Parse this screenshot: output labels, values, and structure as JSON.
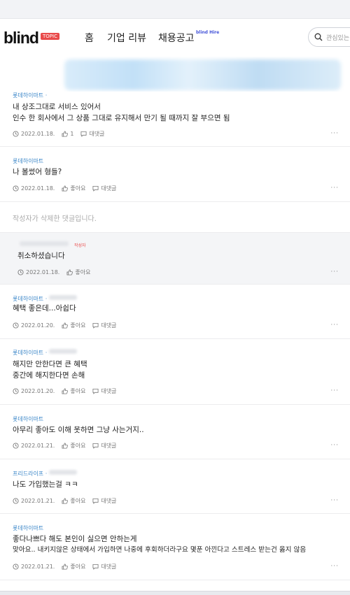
{
  "header": {
    "logo": "blind",
    "topic_badge": "TOPIC",
    "nav_home": "홈",
    "nav_review": "기업 리뷰",
    "nav_jobs": "채용공고",
    "hire_badge": "blind Hire",
    "search_placeholder": "관심있는"
  },
  "comments": [
    {
      "company": "롯데하이마트 · ",
      "lines": [
        "내 상조그대로 서비스 있어서",
        "인수 한 회사에서 그 상품 그대로 유지해서 만기 될 때까지 잘 부으면 됨"
      ],
      "date": "2022.01.18.",
      "like": "1",
      "reply": "대댓글",
      "more": "···"
    },
    {
      "company": "롯데하이마트",
      "lines": [
        "나 볼썼어 형들?"
      ],
      "date": "2022.01.18.",
      "like": "좋아요",
      "reply": "대댓글",
      "more": "···"
    },
    {
      "deleted": "작성자가 삭제한 댓글입니다."
    },
    {
      "author_tag": "작성자",
      "lines": [
        "취소하셨습니다"
      ],
      "date": "2022.01.18.",
      "like": "좋아요",
      "more": "···"
    },
    {
      "company": "롯데하이마트 · ",
      "lines": [
        "혜택 좋은데...아쉽다"
      ],
      "date": "2022.01.20.",
      "like": "좋아요",
      "reply": "대댓글",
      "more": "···"
    },
    {
      "company": "롯데하이마트 · ",
      "lines": [
        "해지만 안한다면 큰 혜택",
        "중간에 해지한다면 손해"
      ],
      "date": "2022.01.20.",
      "like": "좋아요",
      "reply": "대댓글",
      "more": "···"
    },
    {
      "company": "롯데하이마트",
      "lines": [
        "아무리 좋아도 이해 못하면 그냥 사는거지.."
      ],
      "date": "2022.01.21.",
      "like": "좋아요",
      "reply": "대댓글",
      "more": "···"
    },
    {
      "company": "프리드라이프 · ",
      "lines": [
        "나도 가입했는걸 ㅋㅋ"
      ],
      "date": "2022.01.21.",
      "like": "좋아요",
      "reply": "대댓글",
      "more": "···"
    },
    {
      "company": "롯데하이마트",
      "lines": [
        "좋다나쁘다 해도 본인이 싫으면 안하는게",
        "맞아요.. 내키지않은 상태에서 가입하면 나중에 후회하더라구요 몇푼 아낀다고 스트레스 받는건 옳지 않음"
      ],
      "date": "2022.01.21.",
      "like": "좋아요",
      "reply": "대댓글",
      "more": "···"
    }
  ],
  "colors": {
    "accent": "#e94a4a",
    "company": "#3a86c8",
    "hire": "#4353d8"
  },
  "icons": [
    "search-icon",
    "clock-icon",
    "thumbs-up-icon",
    "speech-bubble-icon"
  ]
}
